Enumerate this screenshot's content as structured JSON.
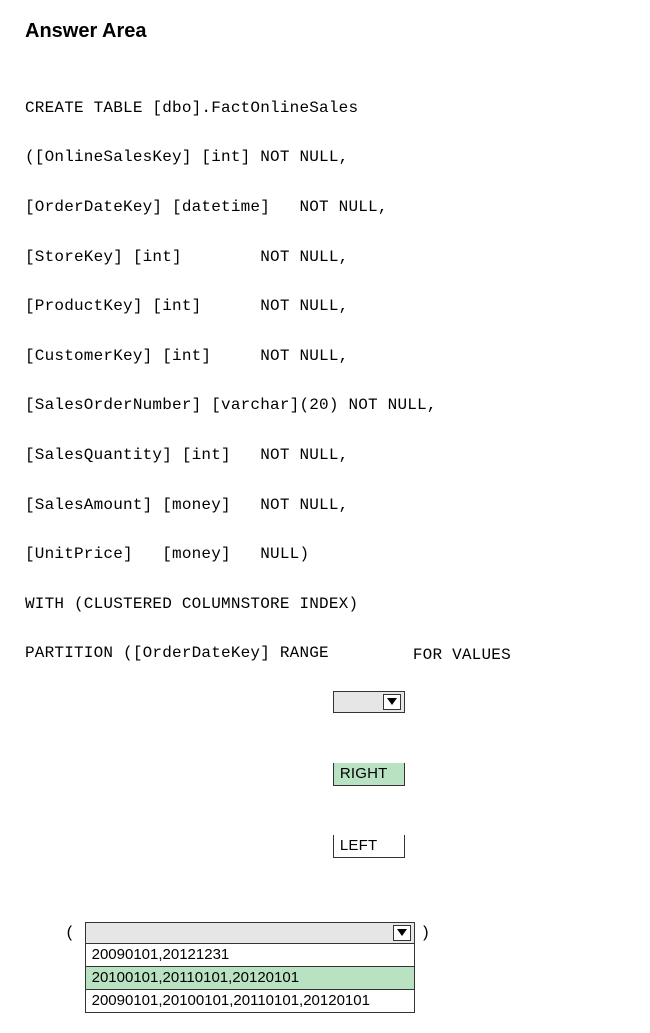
{
  "heading": "Answer Area",
  "code_lines": [
    "CREATE TABLE [dbo].FactOnlineSales",
    "([OnlineSalesKey] [int] NOT NULL,",
    "[OrderDateKey] [datetime]   NOT NULL,",
    "[StoreKey] [int]        NOT NULL,",
    "[ProductKey] [int]      NOT NULL,",
    "[CustomerKey] [int]     NOT NULL,",
    "[SalesOrderNumber] [varchar](20) NOT NULL,",
    "[SalesQuantity] [int]   NOT NULL,",
    "[SalesAmount] [money]   NOT NULL,",
    "[UnitPrice]   [money]   NULL)",
    "WITH (CLUSTERED COLUMNSTORE INDEX)"
  ],
  "partition_prefix": "PARTITION ([OrderDateKey] RANGE",
  "for_values_tail": "FOR VALUES",
  "dropdown1": {
    "selected_placeholder": "",
    "option_right": "RIGHT",
    "option_left": "LEFT"
  },
  "paren_open": "(",
  "paren_close": ")",
  "dropdown2": {
    "selected_placeholder": "",
    "option_a": "20090101,20121231",
    "option_b": "20100101,20110101,20120101",
    "option_c": "20090101,20100101,20110101,20120101"
  }
}
